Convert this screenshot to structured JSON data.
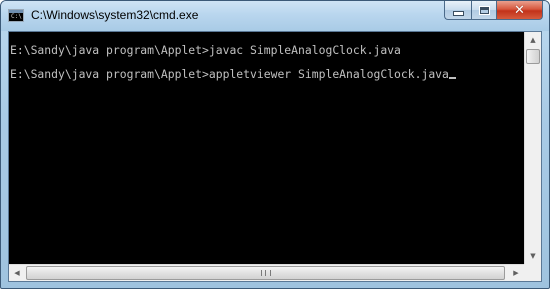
{
  "window": {
    "title": "C:\\Windows\\system32\\cmd.exe",
    "icon": "cmd-icon",
    "icon_text": "C:\\",
    "buttons": {
      "minimize_icon": "minimize-icon",
      "maximize_icon": "maximize-icon",
      "close_icon": "close-icon",
      "close_glyph": "✕"
    }
  },
  "console": {
    "lines": [
      "E:\\Sandy\\java program\\Applet>javac SimpleAnalogClock.java",
      "E:\\Sandy\\java program\\Applet>appletviewer SimpleAnalogClock.java"
    ],
    "text_color": "#c0c0c0",
    "background_color": "#000000"
  },
  "scrollbars": {
    "up_arrow": "▲",
    "down_arrow": "▼",
    "left_arrow": "◀",
    "right_arrow": "▶"
  },
  "colors": {
    "titlebar": "#b9d6ee",
    "close_button": "#c2321a"
  }
}
